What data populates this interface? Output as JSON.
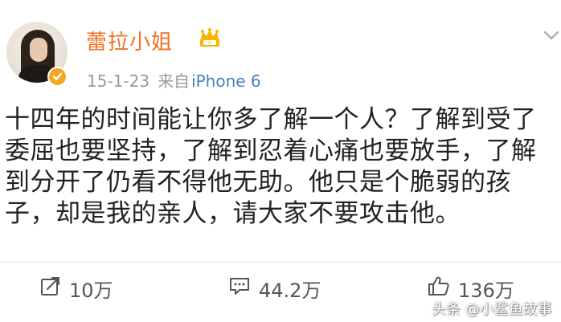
{
  "author": {
    "name": "蕾拉小姐",
    "avatar": "avatar",
    "verified_badge": "verified-badge-icon",
    "member_badge": "crown-icon"
  },
  "meta": {
    "date": "15-1-23",
    "source_prefix": "来自",
    "source_device": "iPhone 6"
  },
  "post": {
    "text": "十四年的时间能让你多了解一个人？了解到受了委屈也要坚持，了解到忍着心痛也要放手，了解到分开了仍看不得他无助。他只是个脆弱的孩子，却是我的亲人，请大家不要攻击他。"
  },
  "actions": {
    "repost": {
      "icon": "share-icon",
      "count": "10万"
    },
    "comment": {
      "icon": "comment-icon",
      "count": "44.2万"
    },
    "like": {
      "icon": "thumbs-up-icon",
      "count": "136万"
    }
  },
  "watermark": "头条 @小鲨鱼故事",
  "colors": {
    "name": "#f26f21",
    "meta": "#999999",
    "source": "#4a7fbd",
    "text": "#222222",
    "verified": "#f5a623"
  }
}
